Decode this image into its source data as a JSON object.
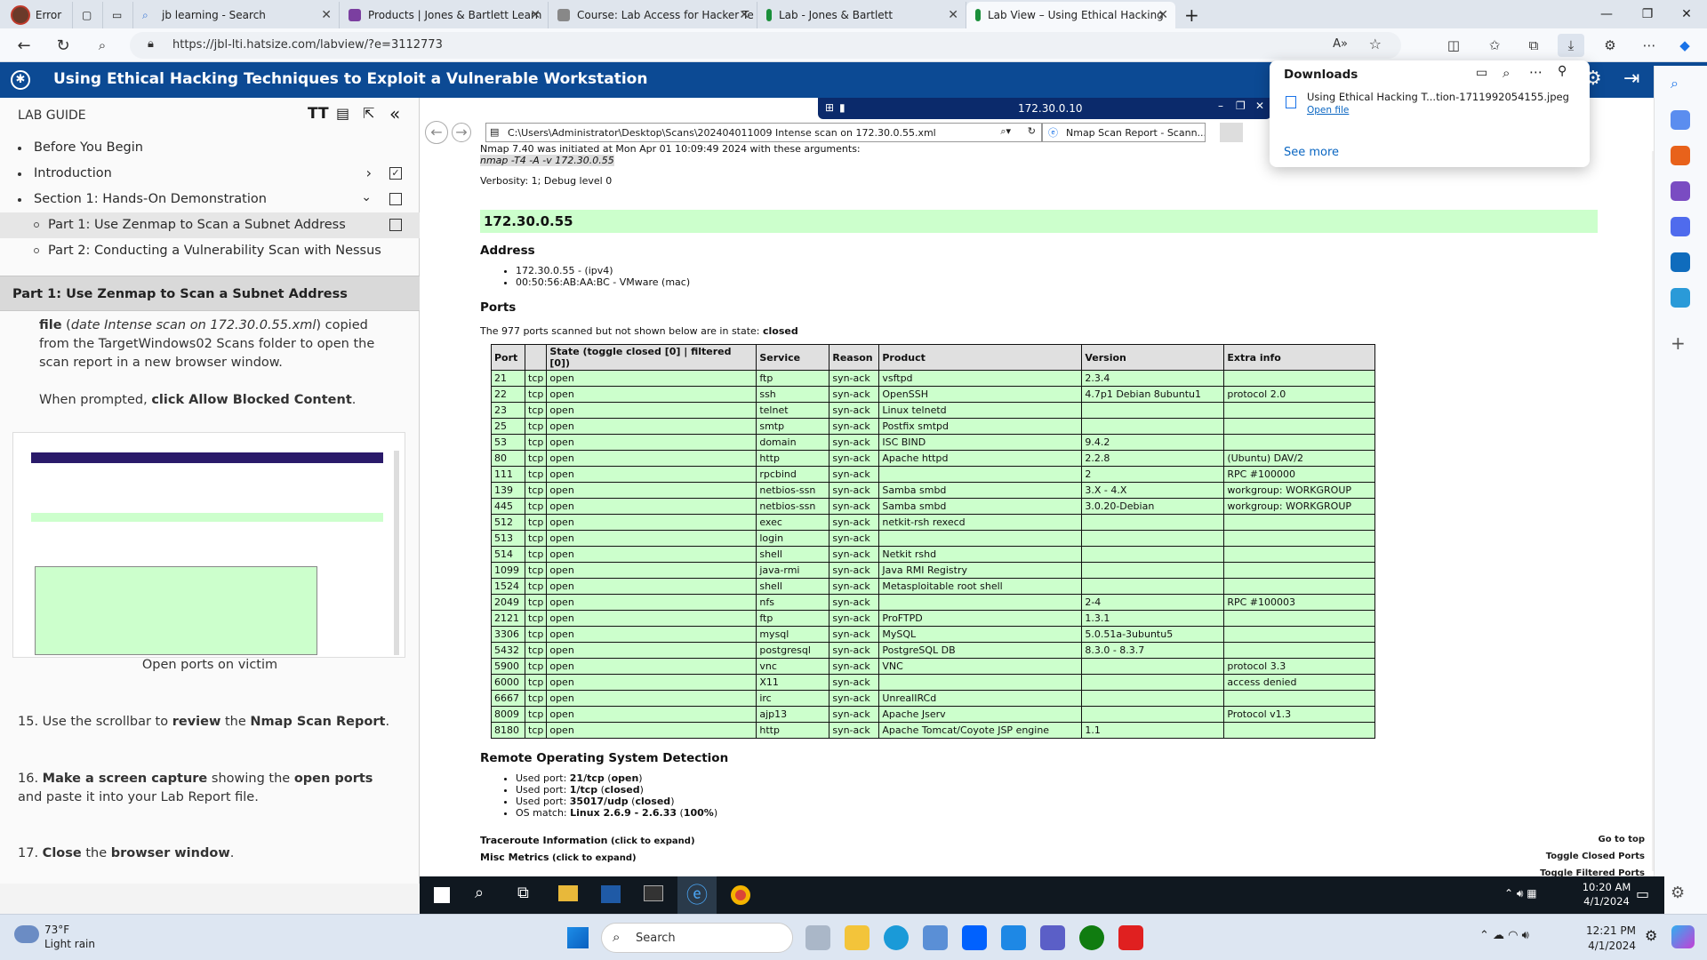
{
  "browser": {
    "profile_label": "Error",
    "tabs": [
      {
        "label": "jb learning - Search",
        "color": "#3a76d6"
      },
      {
        "label": "Products | Jones & Bartlett Learn",
        "color": "#7b3fa0"
      },
      {
        "label": "Course: Lab Access for Hacker Te",
        "color": "#6b6b6b"
      },
      {
        "label": "Lab - Jones & Bartlett",
        "color": "#1a8f3a"
      },
      {
        "label": "Lab View – Using Ethical Hacking",
        "color": "#1a8f3a"
      }
    ],
    "new_tab": "+",
    "url": "https://jbl-lti.hatsize.com/labview/?e=3112773"
  },
  "app": {
    "title": "Using Ethical Hacking Techniques to Exploit a Vulnerable Workstation"
  },
  "guide": {
    "heading": "LAB GUIDE",
    "items": [
      {
        "label": "Before You Begin"
      },
      {
        "label": "Introduction"
      },
      {
        "label": "Section 1: Hands-On Demonstration"
      },
      {
        "label": "Part 1: Use Zenmap to Scan a Subnet Address"
      },
      {
        "label": "Part 2: Conducting a Vulnerability Scan with Nessus"
      }
    ],
    "section_title": "Part 1: Use Zenmap to Scan a Subnet Address",
    "text_file_a": "file",
    "text_file_b": "date Intense scan on 172.30.0.55.xml",
    "text_file_c": ") copied from the TargetWindows02 Scans folder to open the scan report in a new browser window.",
    "text_prompt_a": "When prompted, ",
    "text_prompt_b": "click Allow Blocked Content",
    "text_prompt_c": ".",
    "caption": "Open ports on victim",
    "steps": [
      {
        "num": "15.",
        "a": "Use the scrollbar to ",
        "b": "review",
        "c": " the ",
        "d": "Nmap Scan Report",
        "e": "."
      },
      {
        "num": "16.",
        "a": "",
        "b": "Make a screen capture",
        "c": " showing the ",
        "d": "open ports",
        "e": " and paste it into your Lab Report file."
      },
      {
        "num": "17.",
        "a": "",
        "b": "Close",
        "c": " the ",
        "d": "browser window",
        "e": "."
      }
    ]
  },
  "vm": {
    "ip_banner": "172.30.0.10",
    "ie_path": "C:\\Users\\Administrator\\Desktop\\Scans\\202404011009 Intense scan on 172.30.0.55.xml",
    "ie_tab": "Nmap Scan Report - Scann...",
    "taskbar_time": "10:20 AM",
    "taskbar_date": "4/1/2024"
  },
  "report": {
    "line1": "Nmap 7.40 was initiated at Mon Apr 01 10:09:49 2024 with these arguments:",
    "args": "nmap -T4 -A -v 172.30.0.55",
    "verbosity": "Verbosity: 1; Debug level 0",
    "host": "172.30.0.55",
    "address_h": "Address",
    "addr1": "172.30.0.55 - (ipv4)",
    "addr2": "00:50:56:AB:AA:BC - VMware (mac)",
    "ports_h": "Ports",
    "ports_note_a": "The 977 ports scanned but not shown below are in state: ",
    "ports_note_b": "closed",
    "cols": [
      "Port",
      "",
      "State (toggle closed [0] | filtered [0])",
      "Service",
      "Reason",
      "Product",
      "Version",
      "Extra info"
    ],
    "rows": [
      [
        "21",
        "tcp",
        "open",
        "ftp",
        "syn-ack",
        "vsftpd",
        "2.3.4",
        ""
      ],
      [
        "22",
        "tcp",
        "open",
        "ssh",
        "syn-ack",
        "OpenSSH",
        "4.7p1 Debian 8ubuntu1",
        "protocol 2.0"
      ],
      [
        "23",
        "tcp",
        "open",
        "telnet",
        "syn-ack",
        "Linux telnetd",
        "",
        ""
      ],
      [
        "25",
        "tcp",
        "open",
        "smtp",
        "syn-ack",
        "Postfix smtpd",
        "",
        ""
      ],
      [
        "53",
        "tcp",
        "open",
        "domain",
        "syn-ack",
        "ISC BIND",
        "9.4.2",
        ""
      ],
      [
        "80",
        "tcp",
        "open",
        "http",
        "syn-ack",
        "Apache httpd",
        "2.2.8",
        "(Ubuntu) DAV/2"
      ],
      [
        "111",
        "tcp",
        "open",
        "rpcbind",
        "syn-ack",
        "",
        "2",
        "RPC #100000"
      ],
      [
        "139",
        "tcp",
        "open",
        "netbios-ssn",
        "syn-ack",
        "Samba smbd",
        "3.X - 4.X",
        "workgroup: WORKGROUP"
      ],
      [
        "445",
        "tcp",
        "open",
        "netbios-ssn",
        "syn-ack",
        "Samba smbd",
        "3.0.20-Debian",
        "workgroup: WORKGROUP"
      ],
      [
        "512",
        "tcp",
        "open",
        "exec",
        "syn-ack",
        "netkit-rsh rexecd",
        "",
        ""
      ],
      [
        "513",
        "tcp",
        "open",
        "login",
        "syn-ack",
        "",
        "",
        ""
      ],
      [
        "514",
        "tcp",
        "open",
        "shell",
        "syn-ack",
        "Netkit rshd",
        "",
        ""
      ],
      [
        "1099",
        "tcp",
        "open",
        "java-rmi",
        "syn-ack",
        "Java RMI Registry",
        "",
        ""
      ],
      [
        "1524",
        "tcp",
        "open",
        "shell",
        "syn-ack",
        "Metasploitable root shell",
        "",
        ""
      ],
      [
        "2049",
        "tcp",
        "open",
        "nfs",
        "syn-ack",
        "",
        "2-4",
        "RPC #100003"
      ],
      [
        "2121",
        "tcp",
        "open",
        "ftp",
        "syn-ack",
        "ProFTPD",
        "1.3.1",
        ""
      ],
      [
        "3306",
        "tcp",
        "open",
        "mysql",
        "syn-ack",
        "MySQL",
        "5.0.51a-3ubuntu5",
        ""
      ],
      [
        "5432",
        "tcp",
        "open",
        "postgresql",
        "syn-ack",
        "PostgreSQL DB",
        "8.3.0 - 8.3.7",
        ""
      ],
      [
        "5900",
        "tcp",
        "open",
        "vnc",
        "syn-ack",
        "VNC",
        "",
        "protocol 3.3"
      ],
      [
        "6000",
        "tcp",
        "open",
        "X11",
        "syn-ack",
        "",
        "",
        "access denied"
      ],
      [
        "6667",
        "tcp",
        "open",
        "irc",
        "syn-ack",
        "UnrealIRCd",
        "",
        ""
      ],
      [
        "8009",
        "tcp",
        "open",
        "ajp13",
        "syn-ack",
        "Apache Jserv",
        "",
        "Protocol v1.3"
      ],
      [
        "8180",
        "tcp",
        "open",
        "http",
        "syn-ack",
        "Apache Tomcat/Coyote JSP engine",
        "1.1",
        ""
      ]
    ],
    "os_h": "Remote Operating System Detection",
    "os": [
      {
        "a": "Used port: ",
        "b": "21/tcp",
        "c": " (",
        "d": "open",
        "e": ")"
      },
      {
        "a": "Used port: ",
        "b": "1/tcp",
        "c": " (",
        "d": "closed",
        "e": ")"
      },
      {
        "a": "Used port: ",
        "b": "35017/udp",
        "c": " (",
        "d": "closed",
        "e": ")"
      },
      {
        "a": "OS match: ",
        "b": "Linux 2.6.9 - 2.6.33",
        "c": " (",
        "d": "100%",
        "e": ")"
      }
    ],
    "traceroute": "Traceroute Information",
    "misc": "Misc Metrics",
    "expand": "(click to expand)",
    "goto_top": "Go to top",
    "toggle_closed": "Toggle Closed Ports",
    "toggle_filtered": "Toggle Filtered Ports"
  },
  "downloads": {
    "title": "Downloads",
    "file": "Using Ethical Hacking T...tion-1711992054155.jpeg",
    "open": "Open file",
    "see_more": "See more"
  },
  "taskbar": {
    "temp": "73°F",
    "weather": "Light rain",
    "search": "Search",
    "time": "12:21 PM",
    "date": "4/1/2024"
  }
}
